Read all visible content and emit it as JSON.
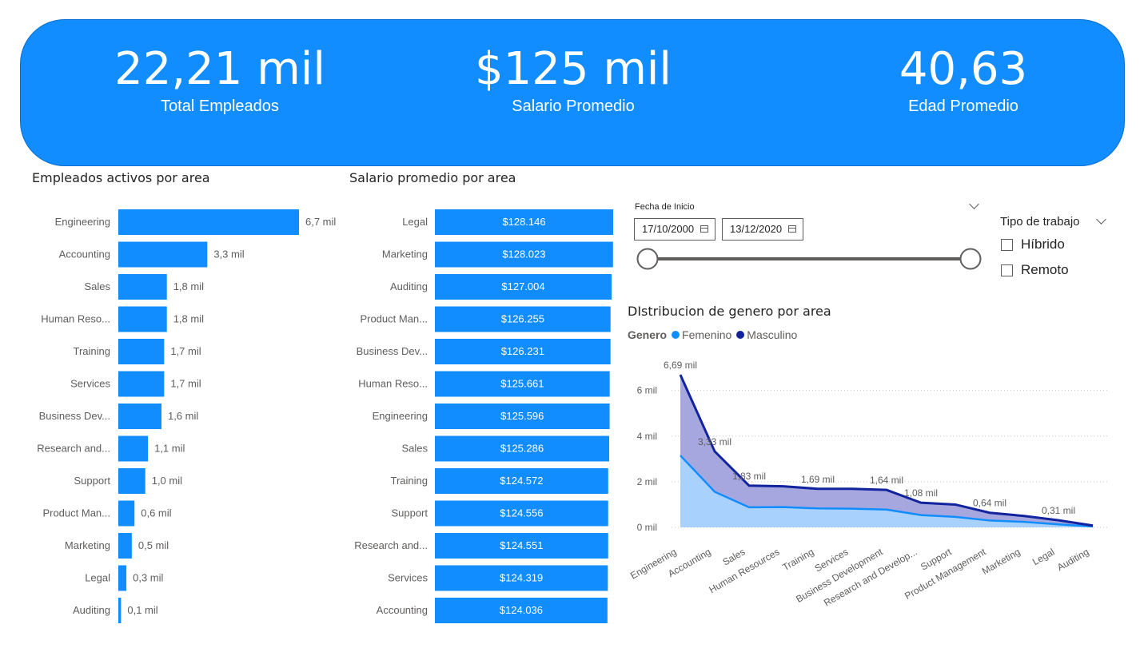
{
  "kpis": [
    {
      "value": "22,21 mil",
      "label": "Total Empleados"
    },
    {
      "value": "$125 mil",
      "label": "Salario Promedio"
    },
    {
      "value": "40,63",
      "label": "Edad Promedio"
    }
  ],
  "colors": {
    "primary": "#118dff",
    "female_fill": "#a8d1fd",
    "male_fill": "#a7a7df",
    "male_line": "#12239e",
    "female_line": "#118dff"
  },
  "slicer_fecha": {
    "title": "Fecha de Inicio",
    "start": "17/10/2000",
    "end": "13/12/2020"
  },
  "slicer_tipo": {
    "title": "Tipo de trabajo",
    "options": [
      "Híbrido",
      "Remoto"
    ]
  },
  "chart_data": [
    {
      "type": "bar",
      "orientation": "horizontal",
      "title": "Empleados activos por area",
      "categories": [
        "Engineering",
        "Accounting",
        "Sales",
        "Human Reso...",
        "Training",
        "Services",
        "Business Dev...",
        "Research and...",
        "Support",
        "Product Man...",
        "Marketing",
        "Legal",
        "Auditing"
      ],
      "values": [
        6700,
        3300,
        1800,
        1800,
        1700,
        1700,
        1600,
        1100,
        1000,
        600,
        500,
        300,
        100
      ],
      "data_labels": [
        "6,7 mil",
        "3,3 mil",
        "1,8 mil",
        "1,8 mil",
        "1,7 mil",
        "1,7 mil",
        "1,6 mil",
        "1,1 mil",
        "1,0 mil",
        "0,6 mil",
        "0,5 mil",
        "0,3 mil",
        "0,1 mil"
      ],
      "xlim": [
        0,
        6700
      ]
    },
    {
      "type": "bar",
      "orientation": "horizontal",
      "title": "Salario promedio por area",
      "categories": [
        "Legal",
        "Marketing",
        "Auditing",
        "Product Man...",
        "Business Dev...",
        "Human Reso...",
        "Engineering",
        "Sales",
        "Training",
        "Support",
        "Research and...",
        "Services",
        "Accounting"
      ],
      "values": [
        128146,
        128023,
        127004,
        126255,
        126231,
        125661,
        125596,
        125286,
        124572,
        124556,
        124551,
        124319,
        124036
      ],
      "data_labels": [
        "$128.146",
        "$128.023",
        "$127.004",
        "$126.255",
        "$126.231",
        "$125.661",
        "$125.596",
        "$125.286",
        "$124.572",
        "$124.556",
        "$124.551",
        "$124.319",
        "$124.036"
      ],
      "xlim": [
        0,
        128146
      ]
    },
    {
      "type": "area",
      "title": "DIstribucion de genero por area",
      "legend_title": "Genero",
      "categories": [
        "Engineering",
        "Accounting",
        "Sales",
        "Human Resources",
        "Training",
        "Services",
        "Business Development",
        "Research and Develop...",
        "Support",
        "Product Management",
        "Marketing",
        "Legal",
        "Auditing"
      ],
      "series": [
        {
          "name": "Femenino",
          "values": [
            3150,
            1560,
            880,
            890,
            830,
            820,
            780,
            540,
            460,
            300,
            240,
            130,
            40
          ]
        },
        {
          "name": "Masculino",
          "values": [
            3540,
            1770,
            950,
            910,
            860,
            870,
            860,
            540,
            540,
            340,
            260,
            180,
            40
          ]
        }
      ],
      "totals": [
        6690,
        3330,
        1830,
        1800,
        1690,
        1690,
        1640,
        1080,
        1000,
        640,
        500,
        310,
        80
      ],
      "total_labels": [
        "6,69 mil",
        "3,33 mil",
        "1,83 mil",
        "",
        "1,69 mil",
        "",
        "1,64 mil",
        "1,08 mil",
        "",
        "0,64 mil",
        "",
        "0,31 mil",
        ""
      ],
      "y_ticks": [
        0,
        2000,
        4000,
        6000
      ],
      "y_tick_labels": [
        "0 mil",
        "2 mil",
        "4 mil",
        "6 mil"
      ],
      "ylim": [
        0,
        6690
      ],
      "grid": true,
      "legend_position": "top-left"
    }
  ]
}
